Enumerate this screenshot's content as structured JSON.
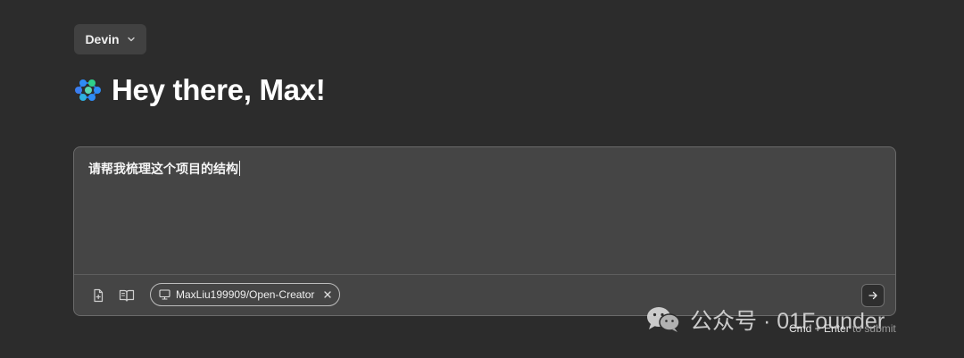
{
  "agent_selector": {
    "label": "Devin"
  },
  "greeting": {
    "text": "Hey there, Max!"
  },
  "composer": {
    "input_value": "请帮我梳理这个项目的结构",
    "repo_chip": {
      "name": "MaxLiu199909/Open-Creator",
      "icon": "monitor-icon"
    },
    "attach_icon": "file-plus-icon",
    "knowledge_icon": "book-icon",
    "send_icon": "arrow-right-icon"
  },
  "shortcut_hint": {
    "keys": "Cmd + Enter",
    "suffix": "to submit"
  },
  "watermark": {
    "text": "公众号 · 01Founder"
  },
  "colors": {
    "background": "#2c2c2c",
    "composer": "#454545",
    "logo_blue": "#2f8cf5",
    "logo_green": "#2fd08a"
  }
}
